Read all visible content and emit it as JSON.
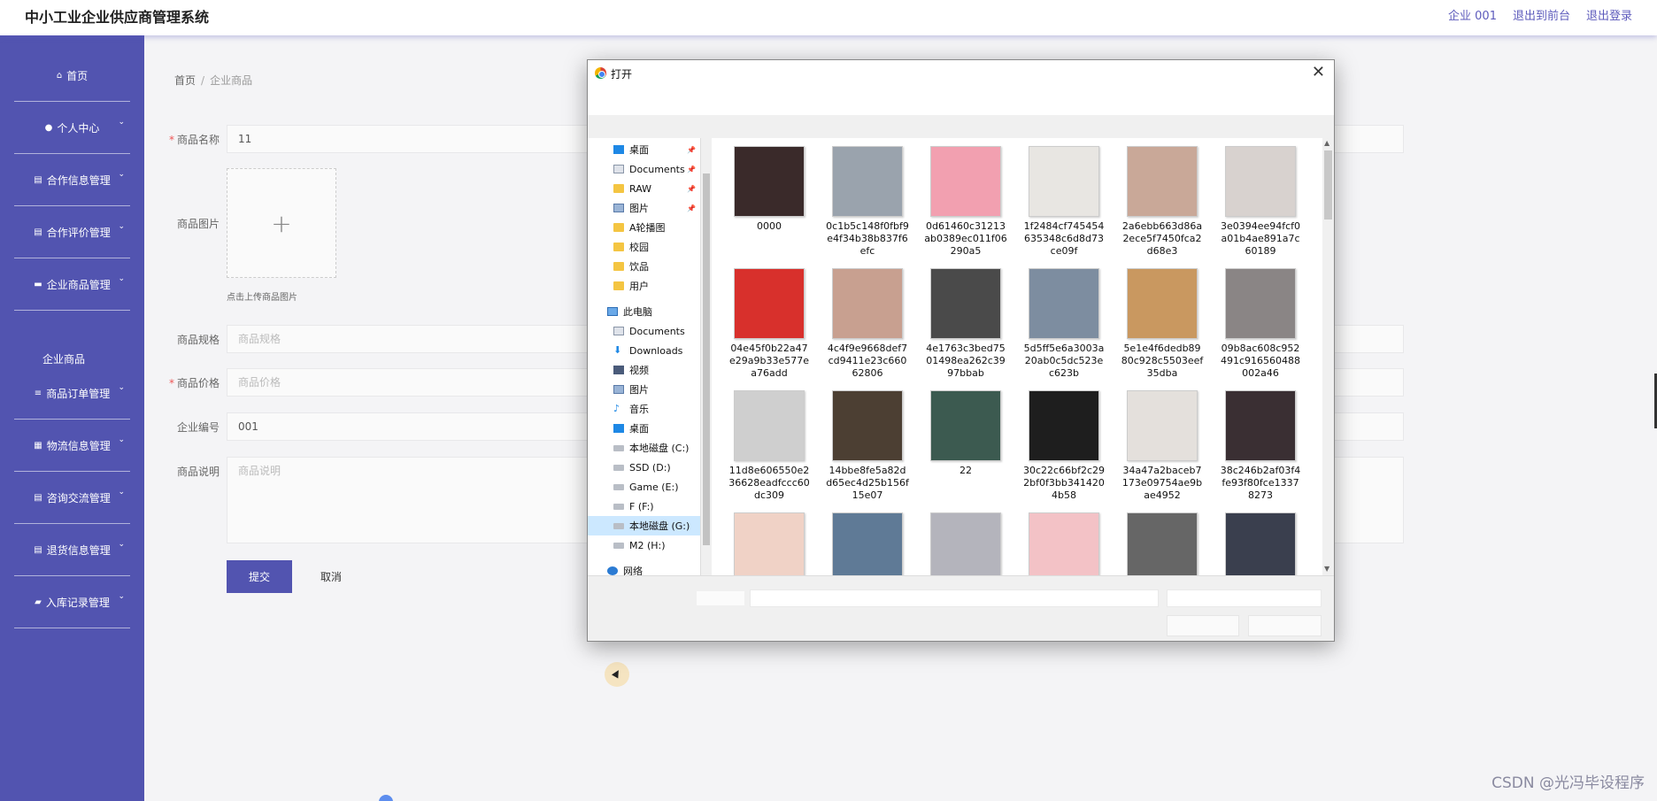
{
  "header": {
    "title": "中小工业企业供应商管理系统",
    "links": [
      "企业 001",
      "退出到前台",
      "退出登录"
    ]
  },
  "sidebar": {
    "items": [
      {
        "label": "首页",
        "icon": "home-icon",
        "has_chevron": false
      },
      {
        "label": "个人中心",
        "icon": "user-icon",
        "has_chevron": true
      },
      {
        "label": "合作信息管理",
        "icon": "doc-icon",
        "has_chevron": true
      },
      {
        "label": "合作评价管理",
        "icon": "doc-icon",
        "has_chevron": true
      },
      {
        "label": "企业商品管理",
        "icon": "monitor-icon",
        "has_chevron": true
      },
      {
        "label": "商品订单管理",
        "icon": "list-icon",
        "has_chevron": true
      },
      {
        "label": "物流信息管理",
        "icon": "grid-icon",
        "has_chevron": true
      },
      {
        "label": "咨询交流管理",
        "icon": "doc-icon",
        "has_chevron": true
      },
      {
        "label": "退货信息管理",
        "icon": "doc-icon",
        "has_chevron": true
      },
      {
        "label": "入库记录管理",
        "icon": "ticket-icon",
        "has_chevron": true
      }
    ],
    "sub_item": "企业商品"
  },
  "breadcrumb": {
    "home": "首页",
    "sep": "/",
    "current": "企业商品"
  },
  "form": {
    "name": {
      "label": "商品名称",
      "value": "11",
      "required": true
    },
    "image": {
      "label": "商品图片",
      "plus": "+",
      "hint": "点击上传商品图片"
    },
    "spec": {
      "label": "商品规格",
      "placeholder": "商品规格"
    },
    "price": {
      "label": "商品价格",
      "placeholder": "商品价格",
      "required": true
    },
    "code": {
      "label": "企业编号",
      "value": "001"
    },
    "desc": {
      "label": "商品说明",
      "placeholder": "商品说明"
    },
    "submit": "提交",
    "cancel": "取消"
  },
  "dialog": {
    "title": "打开",
    "close": "✕",
    "help": "?",
    "nav": [
      {
        "label": "桌面",
        "icon": "desk",
        "pinned": true,
        "indent": 1
      },
      {
        "label": "Documents",
        "icon": "doc",
        "pinned": true,
        "indent": 1
      },
      {
        "label": "RAW",
        "icon": "folder",
        "pinned": true,
        "indent": 1
      },
      {
        "label": "图片",
        "icon": "img",
        "pinned": true,
        "indent": 1
      },
      {
        "label": "A轮播图",
        "icon": "folder",
        "pinned": false,
        "indent": 1
      },
      {
        "label": "校园",
        "icon": "folder",
        "pinned": false,
        "indent": 1
      },
      {
        "label": "饮品",
        "icon": "folder",
        "pinned": false,
        "indent": 1
      },
      {
        "label": "用户",
        "icon": "folder",
        "pinned": false,
        "indent": 1
      },
      {
        "label": "此电脑",
        "icon": "pc",
        "pinned": false,
        "indent": 0,
        "gap": true
      },
      {
        "label": "Documents",
        "icon": "doc",
        "pinned": false,
        "indent": 1
      },
      {
        "label": "Downloads",
        "icon": "dl",
        "pinned": false,
        "indent": 1
      },
      {
        "label": "视频",
        "icon": "vid",
        "pinned": false,
        "indent": 1
      },
      {
        "label": "图片",
        "icon": "img",
        "pinned": false,
        "indent": 1
      },
      {
        "label": "音乐",
        "icon": "music",
        "pinned": false,
        "indent": 1
      },
      {
        "label": "桌面",
        "icon": "desk",
        "pinned": false,
        "indent": 1
      },
      {
        "label": "本地磁盘 (C:)",
        "icon": "drive",
        "pinned": false,
        "indent": 1
      },
      {
        "label": "SSD (D:)",
        "icon": "drive",
        "pinned": false,
        "indent": 1
      },
      {
        "label": "Game (E:)",
        "icon": "drive",
        "pinned": false,
        "indent": 1
      },
      {
        "label": "F (F:)",
        "icon": "drive",
        "pinned": false,
        "indent": 1
      },
      {
        "label": "本地磁盘 (G:)",
        "icon": "drive",
        "pinned": false,
        "indent": 1,
        "selected": true
      },
      {
        "label": "M2 (H:)",
        "icon": "drive",
        "pinned": false,
        "indent": 1
      },
      {
        "label": "网络",
        "icon": "net",
        "pinned": false,
        "indent": 0,
        "gap": true
      }
    ],
    "files": [
      {
        "name": "0000",
        "color": "#3a2a2a"
      },
      {
        "name": "0c1b5c148f0fbf9e4f34b38b837f6efc",
        "color": "#9aa3ad"
      },
      {
        "name": "0d61460c31213ab0389ec011f06290a5",
        "color": "#f2a0b0"
      },
      {
        "name": "1f2484cf745454635348c6d8d73ce09f",
        "color": "#e8e6e2"
      },
      {
        "name": "2a6ebb663d86a2ece5f7450fca2d68e3",
        "color": "#c9a898"
      },
      {
        "name": "3e0394ee94fcf0a01b4ae891a7c60189",
        "color": "#d8d2cf"
      },
      {
        "name": "04e45f0b22a47e29a9b33e577ea76add",
        "color": "#d8302c"
      },
      {
        "name": "4c4f9e9668def7cd9411e23c66062806",
        "color": "#c8a090"
      },
      {
        "name": "4e1763c3bed7501498ea262c3997bbab",
        "color": "#4a4a4a"
      },
      {
        "name": "5d5ff5e6a3003a20ab0c5dc523ec623b",
        "color": "#7d8da0"
      },
      {
        "name": "5e1e4f6dedb8980c928c5503eef35dba",
        "color": "#c99860"
      },
      {
        "name": "09b8ac608c952491c916560488002a46",
        "color": "#8a8585"
      },
      {
        "name": "11d8e606550e236628eadfccc60dc309",
        "color": "#cfcfcf"
      },
      {
        "name": "14bbe8fe5a82dd65ec4d25b156f15e07",
        "color": "#4c3f33"
      },
      {
        "name": "22",
        "color": "#3c5a50"
      },
      {
        "name": "30c22c66bf2c292bf0f3bb3414204b58",
        "color": "#1e1e1e"
      },
      {
        "name": "34a47a2baceb7173e09754ae9bae4952",
        "color": "#e4e0dc"
      },
      {
        "name": "38c246b2af03f4fe93f80fce13378273",
        "color": "#3a2f33"
      },
      {
        "name": "",
        "color": "#f0d2c6"
      },
      {
        "name": "",
        "color": "#5f7a96"
      },
      {
        "name": "",
        "color": "#b4b4bc"
      },
      {
        "name": "",
        "color": "#f3c2c6"
      },
      {
        "name": "",
        "color": "#666666"
      },
      {
        "name": "",
        "color": "#3a3f4e"
      }
    ]
  },
  "watermark": "CSDN @光冯毕设程序"
}
